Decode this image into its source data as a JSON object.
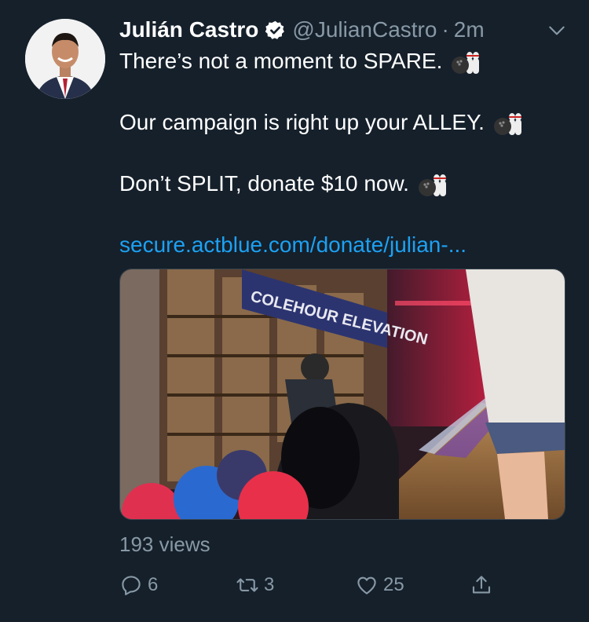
{
  "tweet": {
    "author_name": "Julián Castro",
    "handle": "@JulianCastro",
    "separator": "·",
    "time": "2m",
    "lines": [
      "There’s not a moment to SPARE.",
      "Our campaign is right up your ALLEY.",
      "Don’t SPLIT, donate $10 now."
    ],
    "link_text": "secure.actblue.com/donate/julian-...",
    "video_sign_text": "COLEHOUR ELEVATION",
    "views": "193 views",
    "reply_count": "6",
    "retweet_count": "3",
    "like_count": "25"
  },
  "colors": {
    "background": "#15202b",
    "accent": "#1da1f2",
    "muted": "#8899a6"
  },
  "icons": [
    "verified-badge-icon",
    "chevron-down-icon",
    "bowling-emoji-icon",
    "reply-icon",
    "retweet-icon",
    "like-icon",
    "share-icon"
  ]
}
